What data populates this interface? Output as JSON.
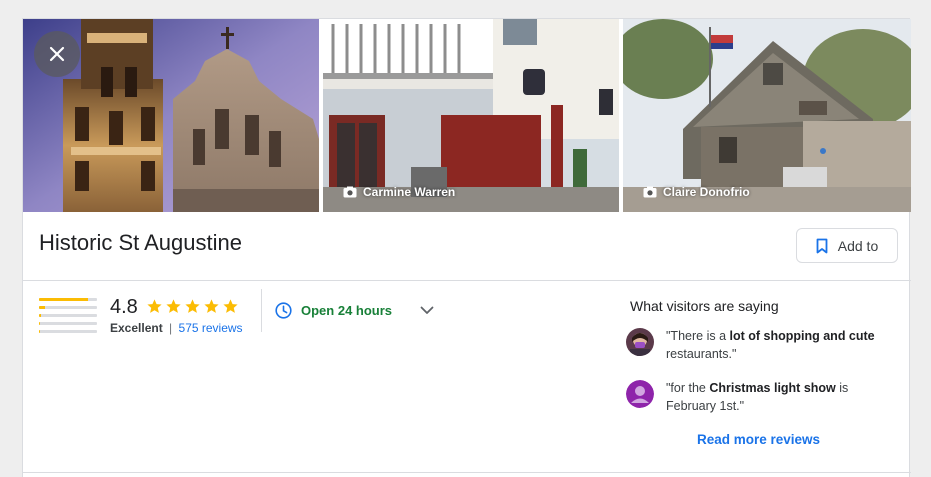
{
  "place": {
    "title": "Historic St Augustine",
    "add_to_label": "Add to"
  },
  "photos": [
    {
      "kind": "church-towers",
      "credit": ""
    },
    {
      "kind": "street-storefront",
      "credit": "Carmine Warren"
    },
    {
      "kind": "wooden-schoolhouse",
      "credit": "Claire Donofrio"
    }
  ],
  "rating": {
    "score": "4.8",
    "stars_filled": 5,
    "label": "Excellent",
    "separator": "|",
    "reviews_text": "575 reviews",
    "distribution_fraction": [
      0.85,
      0.1,
      0.03,
      0.01,
      0.01
    ]
  },
  "hours": {
    "status": "Open 24 hours",
    "status_color": "#188038"
  },
  "visitors": {
    "heading": "What visitors are saying",
    "quotes": [
      {
        "avatar": "photo-avatar",
        "parts": [
          {
            "text": "\"There is a ",
            "bold": false
          },
          {
            "text": "lot of shopping and cute",
            "bold": true
          },
          {
            "text": " restaurants.\"",
            "bold": false
          }
        ]
      },
      {
        "avatar": "person-avatar",
        "parts": [
          {
            "text": "\"for the ",
            "bold": false
          },
          {
            "text": "Christmas light show",
            "bold": true
          },
          {
            "text": " is February 1st.\"",
            "bold": false
          }
        ]
      }
    ],
    "read_more": "Read more reviews"
  },
  "colors": {
    "accent": "#1a73e8",
    "star": "#fbbc04",
    "open_green": "#188038",
    "border": "#dadce0"
  }
}
